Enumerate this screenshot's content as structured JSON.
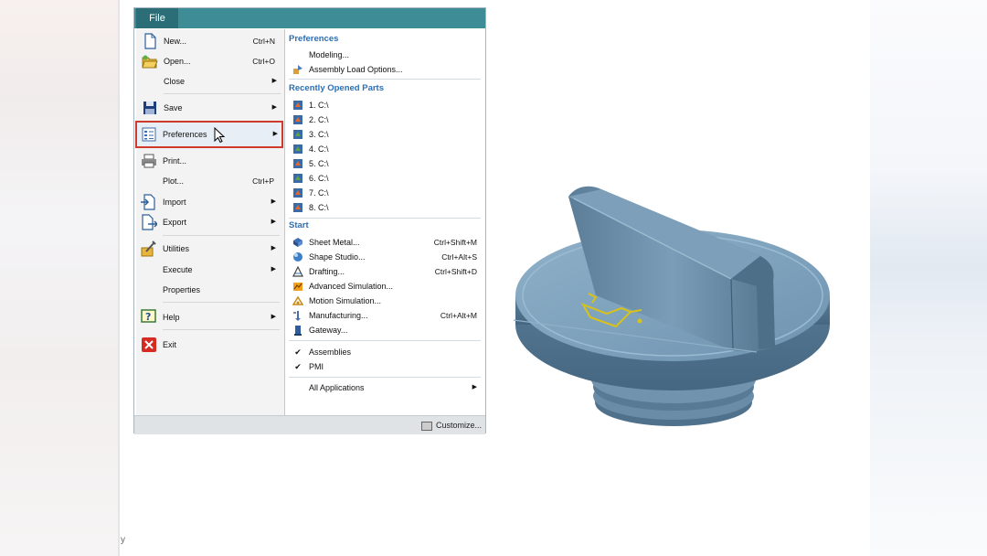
{
  "window": {
    "file_tab": "File",
    "customize": "Customize..."
  },
  "left_menu": [
    {
      "label": "New...",
      "shortcut": "Ctrl+N",
      "icon": "new-file-icon"
    },
    {
      "label": "Open...",
      "shortcut": "Ctrl+O",
      "icon": "open-folder-icon"
    },
    {
      "label": "Close",
      "shortcut": "",
      "arrow": true
    },
    {
      "label": "Save",
      "shortcut": "",
      "arrow": true,
      "icon": "save-icon"
    },
    {
      "label": "Preferences",
      "shortcut": "",
      "arrow": true,
      "icon": "preferences-icon"
    },
    {
      "label": "Print...",
      "shortcut": "",
      "icon": "print-icon"
    },
    {
      "label": "Plot...",
      "shortcut": "Ctrl+P"
    },
    {
      "label": "Import",
      "shortcut": "",
      "arrow": true,
      "icon": "import-icon"
    },
    {
      "label": "Export",
      "shortcut": "",
      "arrow": true,
      "icon": "export-icon"
    },
    {
      "label": "Utilities",
      "shortcut": "",
      "arrow": true,
      "icon": "utilities-icon"
    },
    {
      "label": "Execute",
      "shortcut": "",
      "arrow": true
    },
    {
      "label": "Properties",
      "shortcut": ""
    },
    {
      "label": "Help",
      "shortcut": "",
      "arrow": true,
      "icon": "help-icon"
    },
    {
      "label": "Exit",
      "shortcut": "",
      "icon": "exit-icon"
    }
  ],
  "right_menu": {
    "preferences_header": "Preferences",
    "preferences": [
      {
        "label": "Modeling...",
        "icon": ""
      },
      {
        "label": "Assembly Load Options...",
        "icon": "assembly-load-icon"
      }
    ],
    "recent_header": "Recently Opened Parts",
    "recent": [
      "1. C:\\",
      "2. C:\\",
      "3. C:\\",
      "4. C:\\",
      "5. C:\\",
      "6. C:\\",
      "7. C:\\",
      "8. C:\\"
    ],
    "start_header": "Start",
    "start": [
      {
        "label": "Sheet Metal...",
        "shortcut": "Ctrl+Shift+M",
        "icon": "sheet-metal-icon"
      },
      {
        "label": "Shape Studio...",
        "shortcut": "Ctrl+Alt+S",
        "icon": "shape-studio-icon"
      },
      {
        "label": "Drafting...",
        "shortcut": "Ctrl+Shift+D",
        "icon": "drafting-icon"
      },
      {
        "label": "Advanced Simulation...",
        "shortcut": "",
        "icon": "advanced-simulation-icon"
      },
      {
        "label": "Motion Simulation...",
        "shortcut": "",
        "icon": "motion-simulation-icon"
      },
      {
        "label": "Manufacturing...",
        "shortcut": "Ctrl+Alt+M",
        "icon": "manufacturing-icon"
      },
      {
        "label": "Gateway...",
        "shortcut": "",
        "icon": "gateway-icon"
      }
    ],
    "checked": [
      {
        "label": "Assemblies",
        "icon": "check-icon"
      },
      {
        "label": "PMI",
        "icon": "check-icon"
      }
    ],
    "all_apps": "All Applications"
  },
  "colors": {
    "titlebar": "#3d8c96",
    "accent_header": "#2a6fb5",
    "highlight": "#d03a2c"
  }
}
